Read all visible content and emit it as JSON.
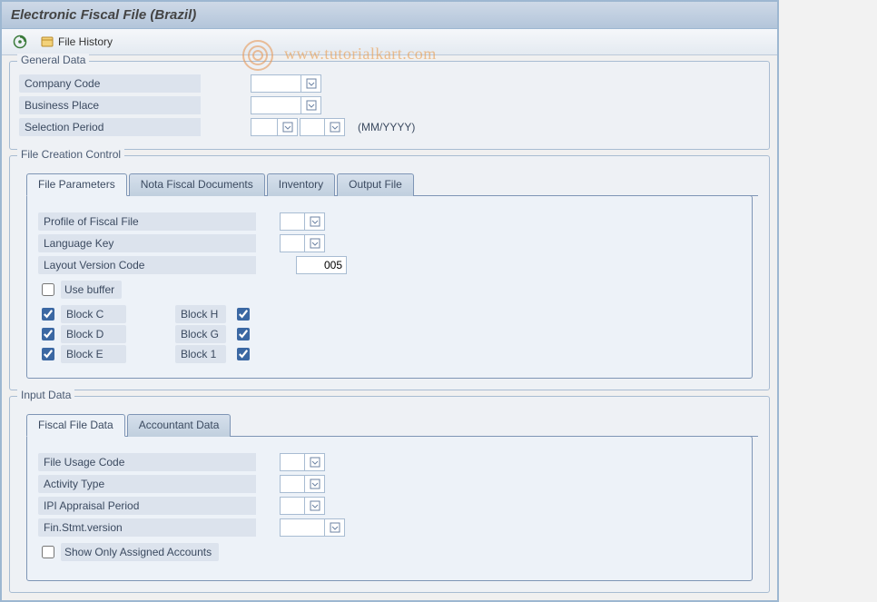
{
  "header": {
    "title": "Electronic Fiscal File (Brazil)",
    "watermark": "www.tutorialkart.com"
  },
  "toolbar": {
    "execute_icon": "execute",
    "file_history_label": "File History"
  },
  "groups": {
    "general": {
      "title": "General Data",
      "company_code": "Company Code",
      "business_place": "Business Place",
      "selection_period": "Selection Period",
      "period_suffix": "(MM/YYYY)"
    },
    "filectrl": {
      "title": "File Creation Control",
      "tabs": {
        "file_params": "File Parameters",
        "nota_fiscal": "Nota Fiscal Documents",
        "inventory": "Inventory",
        "output_file": "Output File"
      },
      "fields": {
        "profile": "Profile of Fiscal File",
        "lang_key": "Language Key",
        "layout_ver": "Layout Version Code",
        "layout_ver_val": "005",
        "use_buffer": "Use buffer",
        "block_c": "Block C",
        "block_d": "Block D",
        "block_e": "Block E",
        "block_h": "Block H",
        "block_g": "Block G",
        "block_1": "Block 1"
      },
      "checks": {
        "use_buffer": false,
        "block_c": true,
        "block_d": true,
        "block_e": true,
        "block_h": true,
        "block_g": true,
        "block_1": true
      }
    },
    "input": {
      "title": "Input Data",
      "tabs": {
        "fiscal_file": "Fiscal File Data",
        "accountant": "Accountant Data"
      },
      "fields": {
        "file_usage": "File Usage Code",
        "activity_type": "Activity Type",
        "ipi": "IPI Appraisal Period",
        "fin_stmt": "Fin.Stmt.version",
        "show_assigned": "Show Only Assigned Accounts"
      },
      "checks": {
        "show_assigned": false
      }
    }
  }
}
